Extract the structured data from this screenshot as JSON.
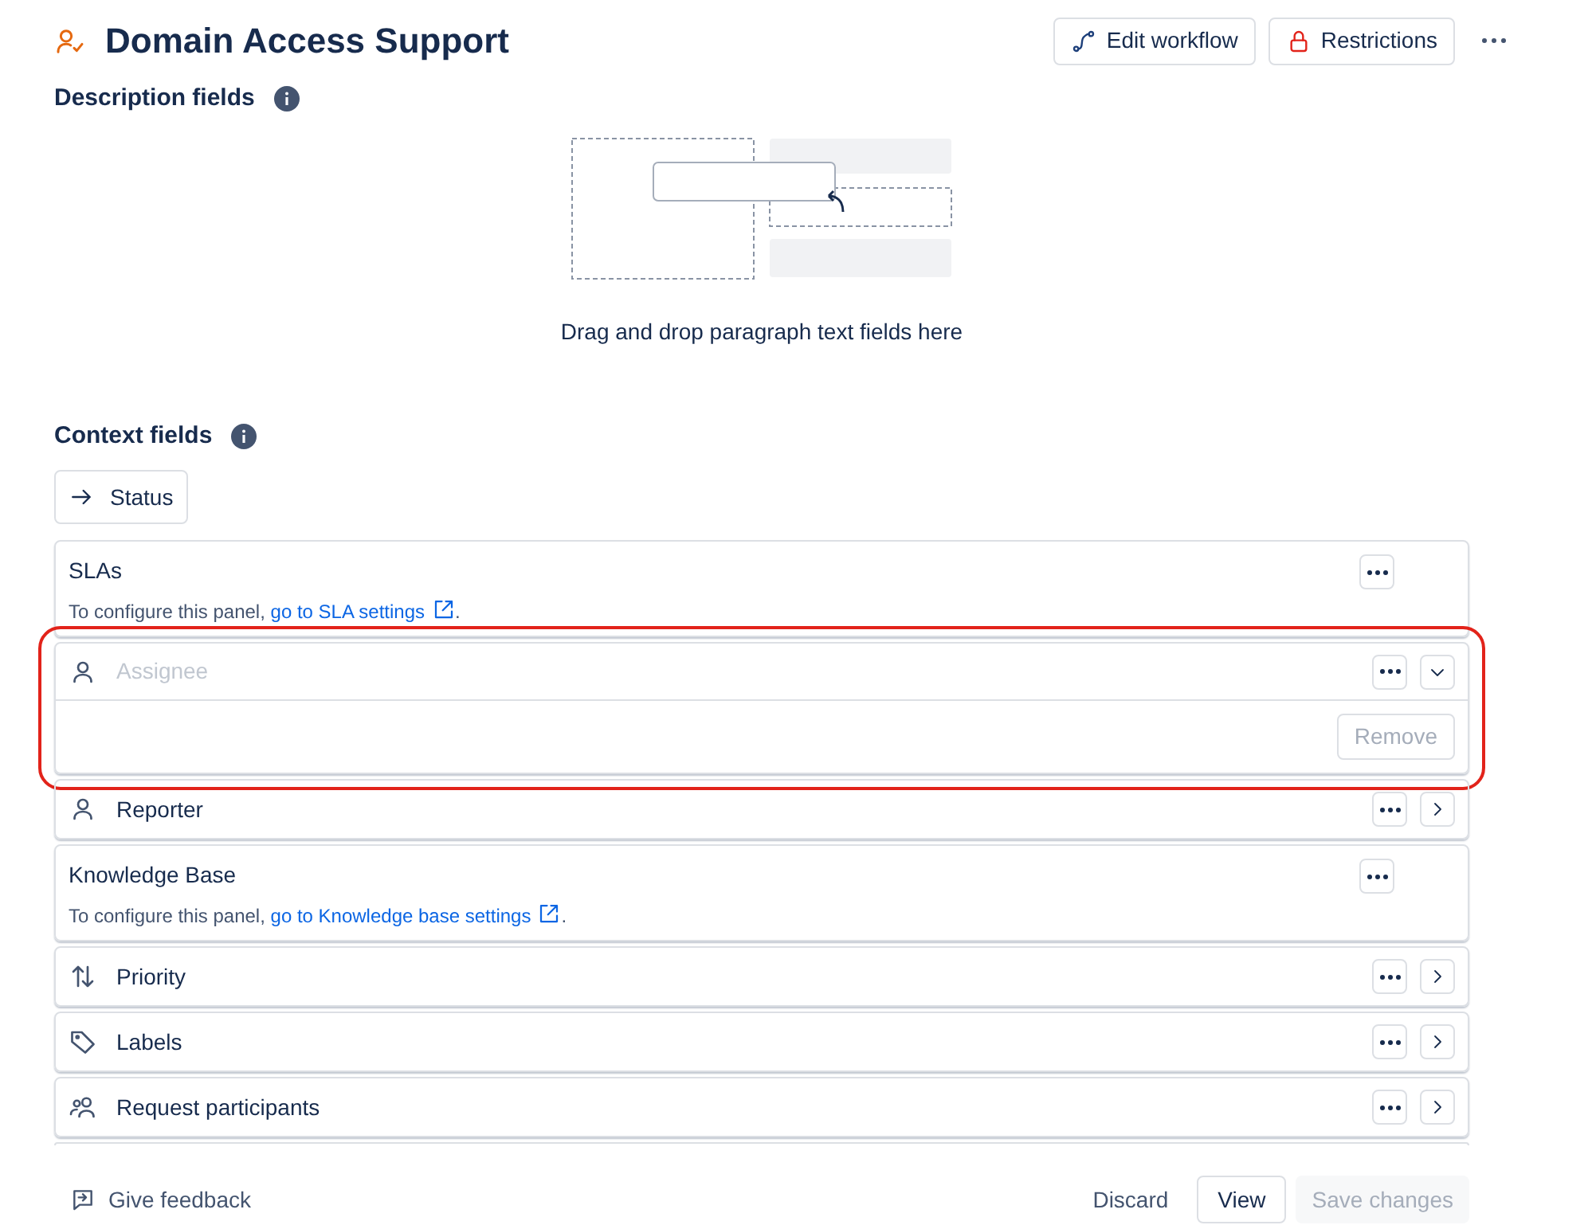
{
  "header": {
    "title": "Domain Access Support",
    "actions": [
      {
        "label": "Edit workflow",
        "kind": "workflow"
      },
      {
        "label": "Restrictions",
        "kind": "lock"
      }
    ]
  },
  "description_section": {
    "title": "Description fields",
    "drop_hint": "Drag and drop paragraph text fields here"
  },
  "context_section": {
    "title": "Context fields",
    "status_button": "Status",
    "fields": [
      {
        "kind": "panel",
        "label": "SLAs",
        "note": "To configure this panel,",
        "link": "go to SLA settings",
        "after": "."
      },
      {
        "kind": "field",
        "label": "Assignee",
        "dimmed": true,
        "expanded": true,
        "highlighted": true,
        "remove": "Remove"
      },
      {
        "kind": "field",
        "label": "Reporter",
        "dimmed": false,
        "expanded": false,
        "highlighted": false
      },
      {
        "kind": "panel",
        "label": "Knowledge Base",
        "note": "To configure this panel,",
        "link": "go to Knowledge base settings",
        "after": "."
      },
      {
        "kind": "field",
        "label": "Priority",
        "dimmed": false,
        "expanded": false,
        "highlighted": false
      },
      {
        "kind": "field",
        "label": "Labels",
        "dimmed": false,
        "expanded": false,
        "highlighted": false
      },
      {
        "kind": "field",
        "label": "Request participants",
        "dimmed": false,
        "expanded": false,
        "highlighted": false
      }
    ]
  },
  "footer": {
    "feedback": "Give feedback",
    "discard": "Discard",
    "view": "View",
    "save": {
      "label": "Save changes",
      "disabled": true
    }
  }
}
